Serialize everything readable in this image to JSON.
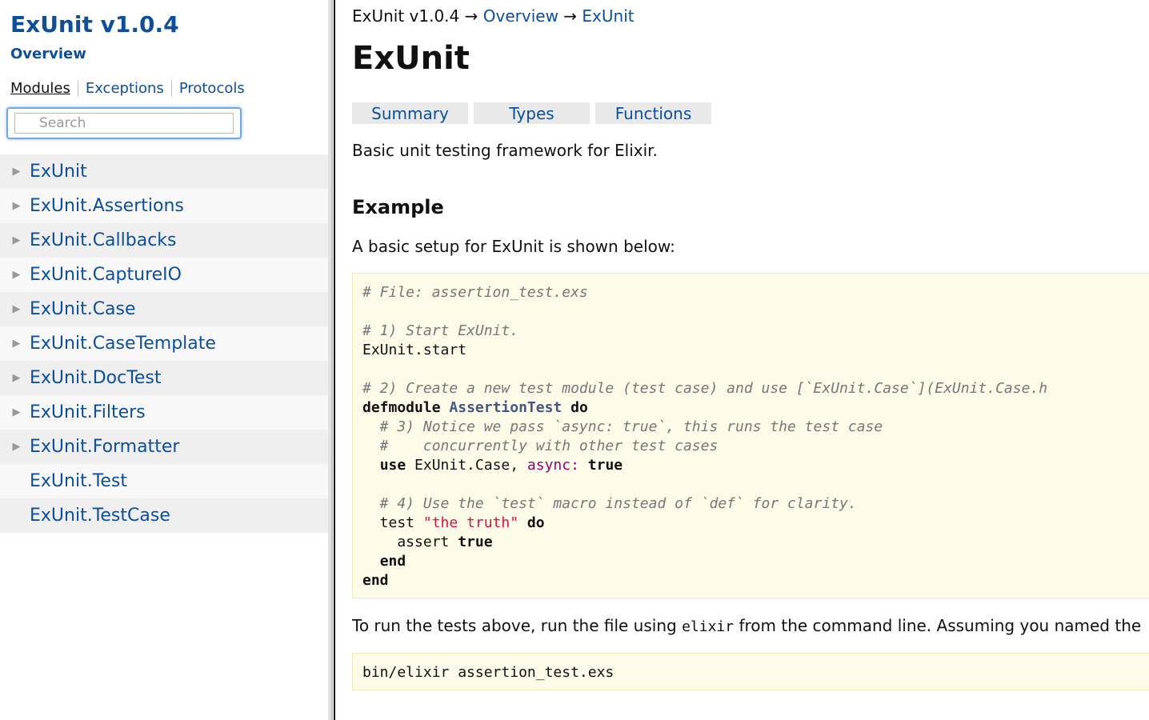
{
  "sidebar": {
    "project_title": "ExUnit v1.0.4",
    "overview_link": "Overview",
    "tabs": [
      {
        "label": "Modules",
        "active": true
      },
      {
        "label": "Exceptions",
        "active": false
      },
      {
        "label": "Protocols",
        "active": false
      }
    ],
    "search": {
      "placeholder": "Search",
      "value": ""
    },
    "modules": [
      {
        "label": "ExUnit",
        "expandable": true
      },
      {
        "label": "ExUnit.Assertions",
        "expandable": true
      },
      {
        "label": "ExUnit.Callbacks",
        "expandable": true
      },
      {
        "label": "ExUnit.CaptureIO",
        "expandable": true
      },
      {
        "label": "ExUnit.Case",
        "expandable": true
      },
      {
        "label": "ExUnit.CaseTemplate",
        "expandable": true
      },
      {
        "label": "ExUnit.DocTest",
        "expandable": true
      },
      {
        "label": "ExUnit.Filters",
        "expandable": true
      },
      {
        "label": "ExUnit.Formatter",
        "expandable": true
      },
      {
        "label": "ExUnit.Test",
        "expandable": false
      },
      {
        "label": "ExUnit.TestCase",
        "expandable": false
      }
    ]
  },
  "content": {
    "breadcrumb": {
      "root": "ExUnit v1.0.4",
      "separator": "→",
      "links": [
        "Overview",
        "ExUnit"
      ]
    },
    "title": "ExUnit",
    "section_tabs": [
      "Summary",
      "Types",
      "Functions"
    ],
    "intro": "Basic unit testing framework for Elixir.",
    "example_heading": "Example",
    "setup_text": "A basic setup for ExUnit is shown below:",
    "code_lines": [
      "# File: assertion_test.exs",
      "",
      "# 1) Start ExUnit.",
      "ExUnit.start",
      "",
      "# 2) Create a new test module (test case) and use [`ExUnit.Case`](ExUnit.Case.h",
      "defmodule AssertionTest do",
      "  # 3) Notice we pass `async: true`, this runs the test case",
      "  #    concurrently with other test cases",
      "  use ExUnit.Case, async: true",
      "",
      "  # 4) Use the `test` macro instead of `def` for clarity.",
      "  test \"the truth\" do",
      "    assert true",
      "  end",
      "end"
    ],
    "run_text_before": "To run the tests above, run the file using ",
    "run_code": "elixir",
    "run_text_after": " from the command line. Assuming you named the",
    "command": "bin/elixir assertion_test.exs"
  },
  "colors": {
    "link": "#0b4f9e",
    "code_background": "#fdfce9",
    "comment": "#777777",
    "string": "#dd1144",
    "symbol": "#990073",
    "class": "#445588"
  }
}
